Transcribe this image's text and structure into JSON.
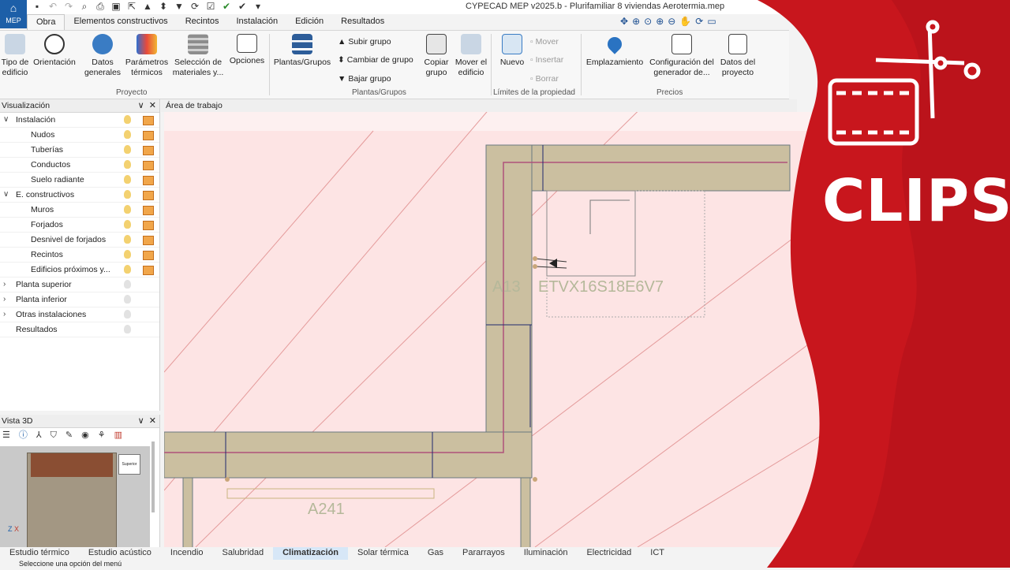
{
  "app": {
    "logo_text": "MEP",
    "title": "CYPECAD MEP v2025.b - Plurifamiliar 8 viviendas Aerotermia.mep"
  },
  "ribbon_tabs": [
    "Obra",
    "Elementos constructivos",
    "Recintos",
    "Instalación",
    "Edición",
    "Resultados"
  ],
  "ribbon": {
    "tipo_edificio": "Tipo de\nedificio",
    "orientacion": "Orientación",
    "datos_generales": "Datos\ngenerales",
    "parametros_termicos": "Parámetros\ntérmicos",
    "seleccion_materiales": "Selección de\nmateriales y...",
    "opciones": "Opciones",
    "group_proyecto": "Proyecto",
    "plantas_grupos": "Plantas/Grupos",
    "subir_grupo": "Subir grupo",
    "cambiar_grupo": "Cambiar de grupo",
    "bajar_grupo": "Bajar grupo",
    "copiar_grupo": "Copiar\ngrupo",
    "mover_edificio": "Mover el\nedificio",
    "group_plantas": "Plantas/Grupos",
    "nuevo": "Nuevo",
    "mover": "Mover",
    "insertar": "Insertar",
    "borrar": "Borrar",
    "group_limites": "Límites de la propiedad",
    "emplazamiento": "Emplazamiento",
    "config_generador": "Configuración del\ngenerador de...",
    "datos_proyecto": "Datos del\nproyecto",
    "group_precios": "Precios"
  },
  "visualizacion": {
    "header": "Visualización",
    "items": [
      {
        "label": "Instalación",
        "caret": "∨",
        "bulb": "on",
        "layer": true,
        "indent": 0
      },
      {
        "label": "Nudos",
        "bulb": "on",
        "layer": true,
        "indent": 1
      },
      {
        "label": "Tuberías",
        "bulb": "on",
        "layer": true,
        "indent": 1
      },
      {
        "label": "Conductos",
        "bulb": "on",
        "layer": true,
        "indent": 1
      },
      {
        "label": "Suelo radiante",
        "bulb": "on",
        "layer": true,
        "indent": 1
      },
      {
        "label": "E. constructivos",
        "caret": "∨",
        "bulb": "on",
        "layer": true,
        "indent": 0
      },
      {
        "label": "Muros",
        "bulb": "on",
        "layer": true,
        "indent": 1
      },
      {
        "label": "Forjados",
        "bulb": "on",
        "layer": true,
        "indent": 1
      },
      {
        "label": "Desnivel de forjados",
        "bulb": "on",
        "layer": true,
        "indent": 1
      },
      {
        "label": "Recintos",
        "bulb": "on",
        "layer": true,
        "indent": 1
      },
      {
        "label": "Edificios próximos y...",
        "bulb": "on",
        "layer": true,
        "indent": 1
      },
      {
        "label": "Planta superior",
        "caret": "›",
        "bulb": "off",
        "layer": false,
        "indent": 0
      },
      {
        "label": "Planta inferior",
        "caret": "›",
        "bulb": "off",
        "layer": false,
        "indent": 0
      },
      {
        "label": "Otras instalaciones",
        "caret": "›",
        "bulb": "off",
        "layer": false,
        "indent": 0
      },
      {
        "label": "Resultados",
        "bulb": "off",
        "layer": false,
        "indent": 0
      }
    ]
  },
  "workarea": {
    "header": "Área de trabajo",
    "label_a13": "A13",
    "label_etvx": "ETVX16S18E6V7",
    "label_a241": "A241"
  },
  "vista3d": {
    "header": "Vista 3D",
    "view_label": "Superior"
  },
  "bottom_tabs": [
    "Estudio térmico",
    "Estudio acústico",
    "Incendio",
    "Salubridad",
    "Climatización",
    "Solar térmica",
    "Gas",
    "Pararrayos",
    "Iluminación",
    "Electricidad",
    "ICT"
  ],
  "active_bottom_tab": "Climatización",
  "status": "Seleccione una opción del menú",
  "brand": {
    "label": "CLIPS",
    "color": "#c8161d"
  }
}
